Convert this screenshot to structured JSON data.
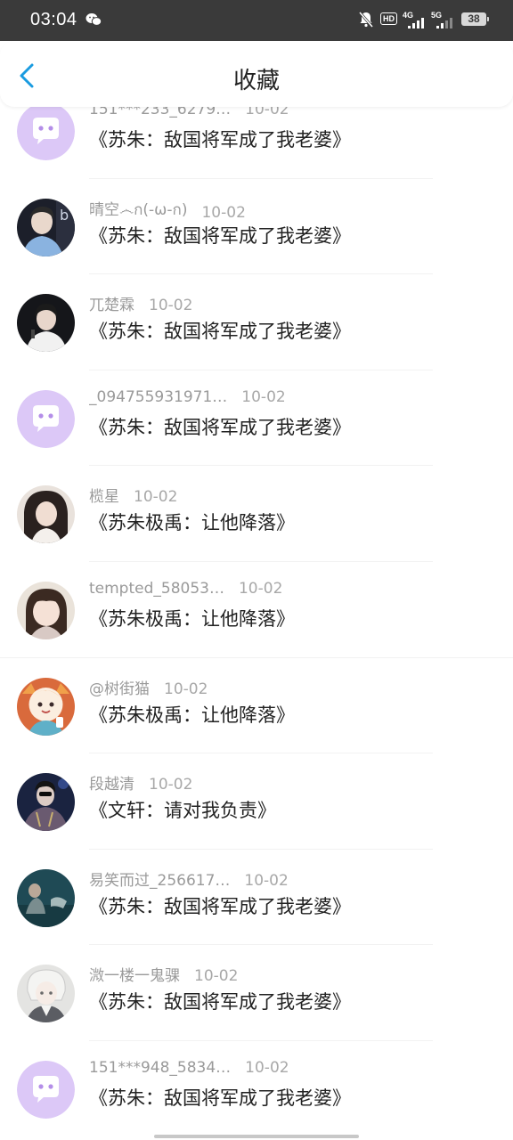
{
  "status_bar": {
    "time": "03:04",
    "hd_label": "HD",
    "signal_4g": "4G",
    "signal_5g": "5G",
    "battery": "38"
  },
  "header": {
    "title": "收藏"
  },
  "items": [
    {
      "user": "151***233_6279…",
      "date": "10-02",
      "title": "《苏朱：敌国将军成了我老婆》",
      "avatar": "default-chat-avatar"
    },
    {
      "user": "晴空෴ก(-ω-ก)",
      "date": "10-02",
      "title": "《苏朱：敌国将军成了我老婆》",
      "avatar": "photo-avatar"
    },
    {
      "user": "兀楚霖",
      "date": "10-02",
      "title": "《苏朱：敌国将军成了我老婆》",
      "avatar": "photo-avatar"
    },
    {
      "user": "_094755931971…",
      "date": "10-02",
      "title": "《苏朱：敌国将军成了我老婆》",
      "avatar": "default-chat-avatar"
    },
    {
      "user": "榄星",
      "date": "10-02",
      "title": "《苏朱极禹：让他降落》",
      "avatar": "photo-avatar"
    },
    {
      "user": "tempted_58053…",
      "date": "10-02",
      "title": "《苏朱极禹：让他降落》",
      "avatar": "photo-avatar"
    },
    {
      "user": "@树街猫",
      "date": "10-02",
      "title": "《苏朱极禹：让他降落》",
      "avatar": "cartoon-avatar"
    },
    {
      "user": "段越清",
      "date": "10-02",
      "title": "《文轩：请对我负责》",
      "avatar": "photo-avatar"
    },
    {
      "user": "易笑而过_256617…",
      "date": "10-02",
      "title": "《苏朱：敌国将军成了我老婆》",
      "avatar": "photo-avatar"
    },
    {
      "user": "溦一楼一鬼骒",
      "date": "10-02",
      "title": "《苏朱：敌国将军成了我老婆》",
      "avatar": "anime-avatar"
    },
    {
      "user": "151***948_5834…",
      "date": "10-02",
      "title": "《苏朱：敌国将军成了我老婆》",
      "avatar": "default-chat-avatar"
    }
  ],
  "colors": {
    "status_bar_bg": "#3a3a3a",
    "accent_blue": "#1a9be0",
    "default_avatar_bg": "#dcc8f7",
    "meta_text": "#9a9a9a",
    "title_text": "#222222"
  }
}
